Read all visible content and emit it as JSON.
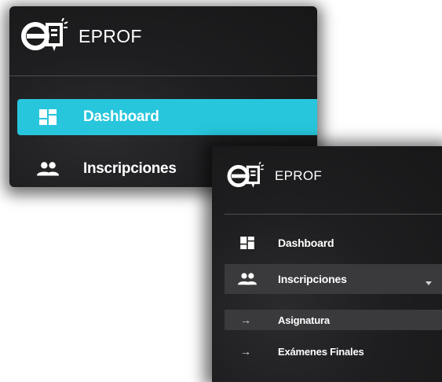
{
  "app": {
    "name": "EPROF",
    "accent_color": "#27c6dc"
  },
  "panel_collapsed": {
    "logo_icon": "eprof-logo-icon",
    "items": [
      {
        "label": "Dashboard",
        "icon": "dashboard-icon",
        "active": true
      },
      {
        "label": "Inscripciones",
        "icon": "people-icon",
        "active": false
      }
    ]
  },
  "panel_expanded": {
    "logo_icon": "eprof-logo-icon",
    "items": [
      {
        "label": "Dashboard",
        "icon": "dashboard-icon"
      },
      {
        "label": "Inscripciones",
        "icon": "people-icon",
        "expanded": true,
        "caret_icon": "caret-down-icon"
      }
    ],
    "subitems": [
      {
        "label": "Asignatura",
        "icon": "arrow-right-icon",
        "selected": true
      },
      {
        "label": "Exámenes Finales",
        "icon": "arrow-right-icon",
        "selected": false
      }
    ]
  }
}
